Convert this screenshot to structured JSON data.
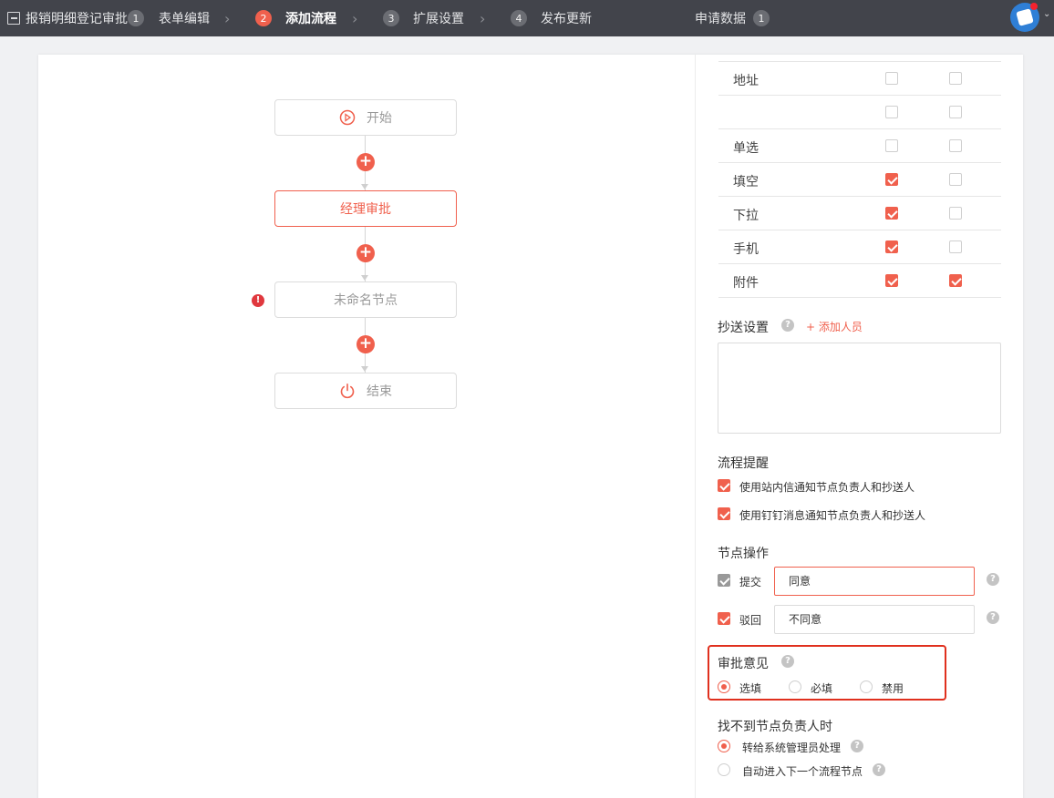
{
  "topbar": {
    "form_title": "报销明细登记审批",
    "steps": [
      {
        "num": "1",
        "label": "表单编辑"
      },
      {
        "num": "2",
        "label": "添加流程"
      },
      {
        "num": "3",
        "label": "扩展设置"
      },
      {
        "num": "4",
        "label": "发布更新"
      }
    ],
    "apply_data_label": "申请数据",
    "apply_data_count": "1",
    "chevron": "›",
    "caret": "⌄"
  },
  "flow": {
    "start": "开始",
    "manager": "经理审批",
    "unnamed": "未命名节点",
    "end": "结束",
    "add_symbol": "+",
    "warn_symbol": "!"
  },
  "fields": [
    {
      "label": "地址",
      "col1": false,
      "col2": false
    },
    {
      "label": "",
      "col1": false,
      "col2": false
    },
    {
      "label": "单选",
      "col1": false,
      "col2": false
    },
    {
      "label": "填空",
      "col1": true,
      "col2": false
    },
    {
      "label": "下拉",
      "col1": true,
      "col2": false
    },
    {
      "label": "手机",
      "col1": true,
      "col2": false
    },
    {
      "label": "附件",
      "col1": true,
      "col2": true
    }
  ],
  "cc_settings": {
    "title": "抄送设置",
    "add_label": "+ 添加人员",
    "help": "?"
  },
  "reminder": {
    "title": "流程提醒",
    "opt1": "使用站内信通知节点负责人和抄送人",
    "opt2": "使用钉钉消息通知节点负责人和抄送人"
  },
  "node_ops": {
    "title": "节点操作",
    "submit_label": "提交",
    "submit_value": "同意",
    "reject_label": "驳回",
    "reject_value": "不同意"
  },
  "opinion": {
    "title": "审批意见",
    "optional": "选填",
    "required": "必填",
    "disabled": "禁用"
  },
  "no_owner": {
    "title": "找不到节点负责人时",
    "opt1": "转给系统管理员处理",
    "opt2": "自动进入下一个流程节点"
  },
  "colors": {
    "accent": "#f0604d",
    "topbar": "#42444b",
    "highlight": "#e0301e"
  }
}
